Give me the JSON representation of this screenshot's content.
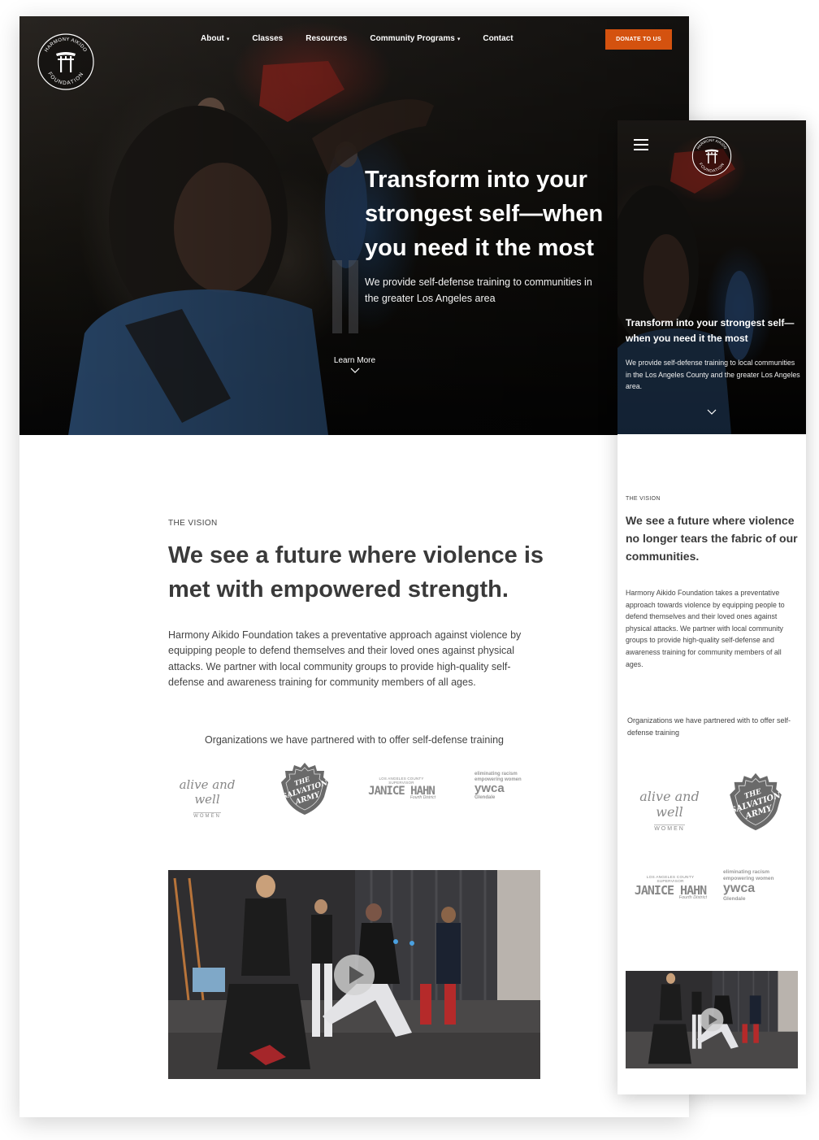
{
  "brand": {
    "logo_text_top": "HARMONY AIKIDO",
    "logo_text_bottom": "FOUNDATION",
    "accent_color": "#d4520f"
  },
  "nav": {
    "items": [
      {
        "label": "About",
        "has_dropdown": true
      },
      {
        "label": "Classes",
        "has_dropdown": false
      },
      {
        "label": "Resources",
        "has_dropdown": false
      },
      {
        "label": "Community Programs",
        "has_dropdown": true
      },
      {
        "label": "Contact",
        "has_dropdown": false
      }
    ],
    "donate_label": "DONATE TO US",
    "caret_glyph": "▾"
  },
  "desktop": {
    "hero": {
      "title": "Transform into your strongest self—when you need it the most",
      "subtitle": "We provide self-defense training to communities in the greater Los Angeles area",
      "learn_more": "Learn More"
    },
    "vision": {
      "eyebrow": "THE VISION",
      "heading": "We see a future where violence is met with empowered strength.",
      "body": "Harmony Aikido Foundation takes a preventative approach against violence by equipping people to defend themselves and their loved ones against physical attacks. We partner with local community groups to provide high-quality self-defense and awareness training for community members of all ages."
    },
    "partners_label": "Organizations we have partnered with to offer self-defense training"
  },
  "mobile": {
    "hero": {
      "title": "Transform into your strongest self—when you need it the most",
      "subtitle": "We provide self-defense training to local communities in the Los Angeles County and the greater Los Angeles area."
    },
    "vision": {
      "eyebrow": "THE VISION",
      "heading": "We see a future where violence no longer tears the fabric of our communities.",
      "body": "Harmony Aikido Foundation takes a preventative approach towards violence by equipping people to defend themselves and their loved ones against physical attacks. We partner with local community groups to provide high-quality self-defense and awareness training for community members of all ages."
    },
    "partners_label": "Organizations we have partnered with to offer self-defense training"
  },
  "partners": {
    "alive_and_well": {
      "script": "alive and well",
      "sub": "WOMEN"
    },
    "salvation_army": {
      "line1": "THE",
      "line2": "SALVATION",
      "line3": "ARMY"
    },
    "janice_hahn": {
      "top": "LOS ANGELES COUNTY SUPERVISOR",
      "name": "JANICE HAHN",
      "district": "Fourth District"
    },
    "ywca": {
      "line1": "eliminating racism",
      "line2": "empowering women",
      "name": "ywca",
      "city": "Glendale"
    }
  },
  "icons": {
    "play": "play-icon",
    "chevron": "chevron-down-icon",
    "menu": "hamburger-menu-icon"
  }
}
